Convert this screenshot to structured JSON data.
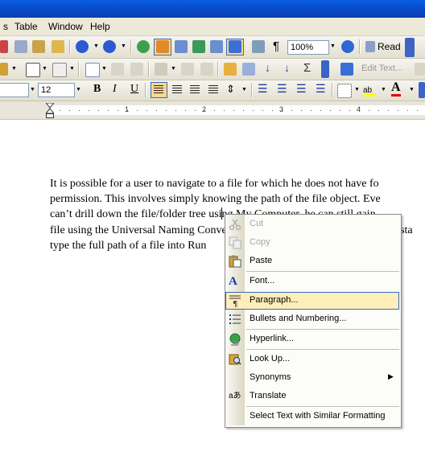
{
  "menubar": {
    "items": [
      "Table",
      "Window",
      "Help"
    ]
  },
  "toolbar": {
    "zoom": "100%",
    "read_label": "Read",
    "edit_text_label": "Edit Text...",
    "font_size": "12",
    "bold": "B",
    "italic": "I",
    "underline": "U",
    "font_color_glyph": "A"
  },
  "ruler": {
    "numbers": [
      "1",
      "2",
      "3",
      "4"
    ]
  },
  "document": {
    "lines": [
      "It is possible for a user to navigate to a file for which he does not have fo",
      "permission. This involves simply knowing the path of the file object. Eve",
      "can’t drill down the file/folder tree using My Computer, he can still gain",
      "file using the Universal Naming Convention (UNC) path. In this case, he can sta",
      "type the full path of a file into Run"
    ]
  },
  "context_menu": {
    "items": [
      {
        "label": "Cut",
        "icon": "scissors-icon",
        "enabled": false
      },
      {
        "label": "Copy",
        "icon": "copy-icon",
        "enabled": false
      },
      {
        "label": "Paste",
        "icon": "paste-icon",
        "enabled": true
      },
      {
        "label": "Font...",
        "icon": "font-icon",
        "enabled": true
      },
      {
        "label": "Paragraph...",
        "icon": "paragraph-icon",
        "enabled": true,
        "highlighted": true
      },
      {
        "label": "Bullets and Numbering...",
        "icon": "bullets-icon",
        "enabled": true
      },
      {
        "label": "Hyperlink...",
        "icon": "hyperlink-icon",
        "enabled": true
      },
      {
        "label": "Look Up...",
        "icon": "lookup-icon",
        "enabled": true
      },
      {
        "label": "Synonyms",
        "icon": "",
        "enabled": true,
        "submenu": true
      },
      {
        "label": "Translate",
        "icon": "translate-icon",
        "enabled": true
      },
      {
        "label": "Select Text with Similar Formatting",
        "icon": "",
        "enabled": true
      }
    ]
  },
  "colors": {
    "highlight_bg": "#ffeeb8",
    "highlight_border": "#316ac5",
    "toolbar_bg": "#ece9d8",
    "titlebar": "#0848c4"
  }
}
